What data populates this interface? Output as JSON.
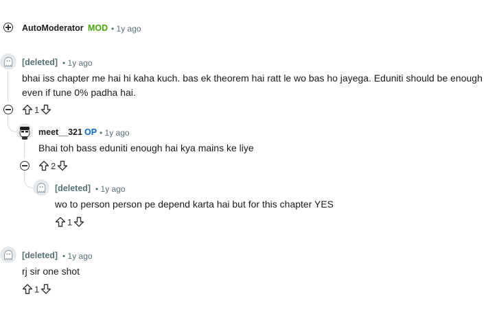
{
  "comments": [
    {
      "author": "AutoModerator",
      "badge": "MOD",
      "time": "• 1y ago"
    },
    {
      "author": "[deleted]",
      "time": "• 1y ago",
      "body_line1": "bhai iss chapter me hai hi kaha kuch. bas ek theorem hai ratt le wo bas ho jayega. Eduniti should be enough",
      "body_line2": "even if tune 0% padha hai.",
      "votes": "1"
    },
    {
      "author": "meet__321",
      "badge": "OP",
      "time": "• 1y ago",
      "body": "Bhai toh bass eduniti enough hai kya mains ke liye",
      "votes": "2"
    },
    {
      "author": "[deleted]",
      "time": "• 1y ago",
      "body": "wo to person person pe depend karta hai but for this chapter YES",
      "votes": "1"
    },
    {
      "author": "[deleted]",
      "time": "• 1y ago",
      "body": "rj sir one shot",
      "votes": "1"
    }
  ],
  "icons": {
    "expand": "plus-circle-icon",
    "collapse": "minus-circle-icon",
    "upvote": "upvote-arrow-icon",
    "downvote": "downvote-arrow-icon",
    "deleted_avatar": "deleted-user-avatar-icon",
    "user_avatar": "snoo-avatar-icon"
  }
}
